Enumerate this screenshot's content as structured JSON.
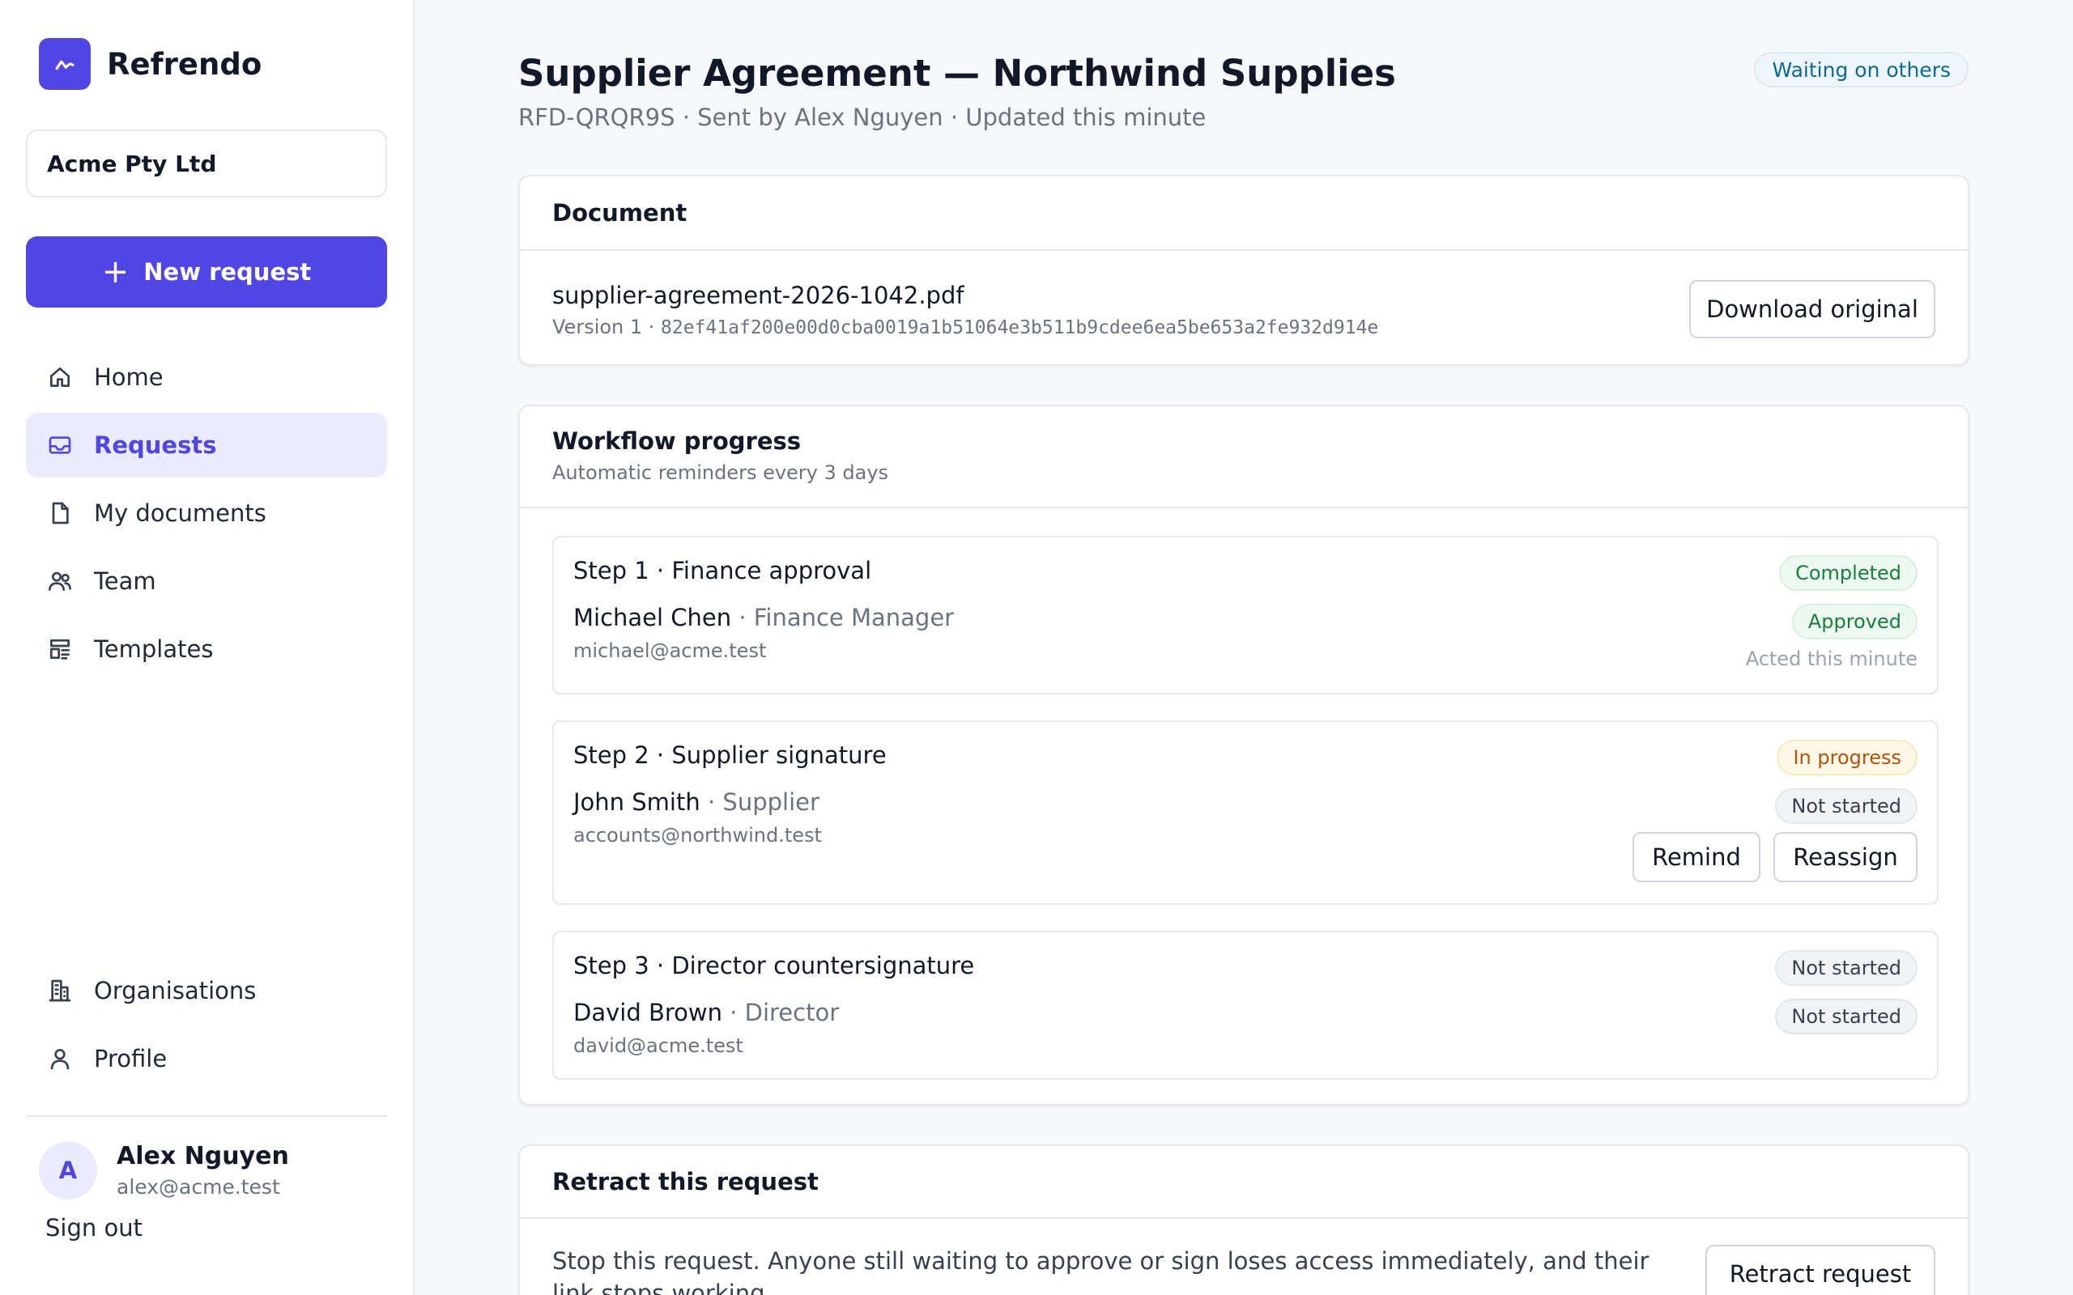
{
  "app": {
    "name": "Refrendo",
    "organisation": "Acme Pty Ltd",
    "new_request_label": "New request"
  },
  "nav": {
    "home": "Home",
    "requests": "Requests",
    "my_documents": "My documents",
    "team": "Team",
    "templates": "Templates",
    "organisations": "Organisations",
    "profile": "Profile"
  },
  "user": {
    "initial": "A",
    "name": "Alex Nguyen",
    "email": "alex@acme.test",
    "sign_out": "Sign out"
  },
  "request": {
    "title": "Supplier Agreement — Northwind Supplies",
    "subtitle": "RFD-QRQR9S · Sent by Alex Nguyen · Updated this minute",
    "status": "Waiting on others"
  },
  "document": {
    "section_title": "Document",
    "file_name": "supplier-agreement-2026-1042.pdf",
    "version": "Version 1 · ",
    "hash": "82ef41af200e00d0cba0019a1b51064e3b511b9cdee6ea5be653a2fe932d914e",
    "download_label": "Download original"
  },
  "workflow": {
    "section_title": "Workflow progress",
    "subtitle": "Automatic reminders every 3 days",
    "steps": [
      {
        "title": "Step 1 · Finance approval",
        "status": "Completed",
        "name": "Michael Chen",
        "role": " · Finance Manager",
        "email": "michael@acme.test",
        "participant_status": "Approved",
        "acted": "Acted this minute"
      },
      {
        "title": "Step 2 · Supplier signature",
        "status": "In progress",
        "name": "John Smith",
        "role": " · Supplier",
        "email": "accounts@northwind.test",
        "participant_status": "Not started",
        "remind_label": "Remind",
        "reassign_label": "Reassign"
      },
      {
        "title": "Step 3 · Director countersignature",
        "status": "Not started",
        "name": "David Brown",
        "role": " · Director",
        "email": "david@acme.test",
        "participant_status": "Not started"
      }
    ]
  },
  "retract": {
    "section_title": "Retract this request",
    "description": "Stop this request. Anyone still waiting to approve or sign loses access immediately, and their link stops working.",
    "button_label": "Retract request"
  },
  "colors": {
    "accent": "#4f46e5",
    "accent_soft": "#ecebfd",
    "success": "#15803d",
    "warning": "#b45309",
    "info": "#0b6a8f"
  }
}
